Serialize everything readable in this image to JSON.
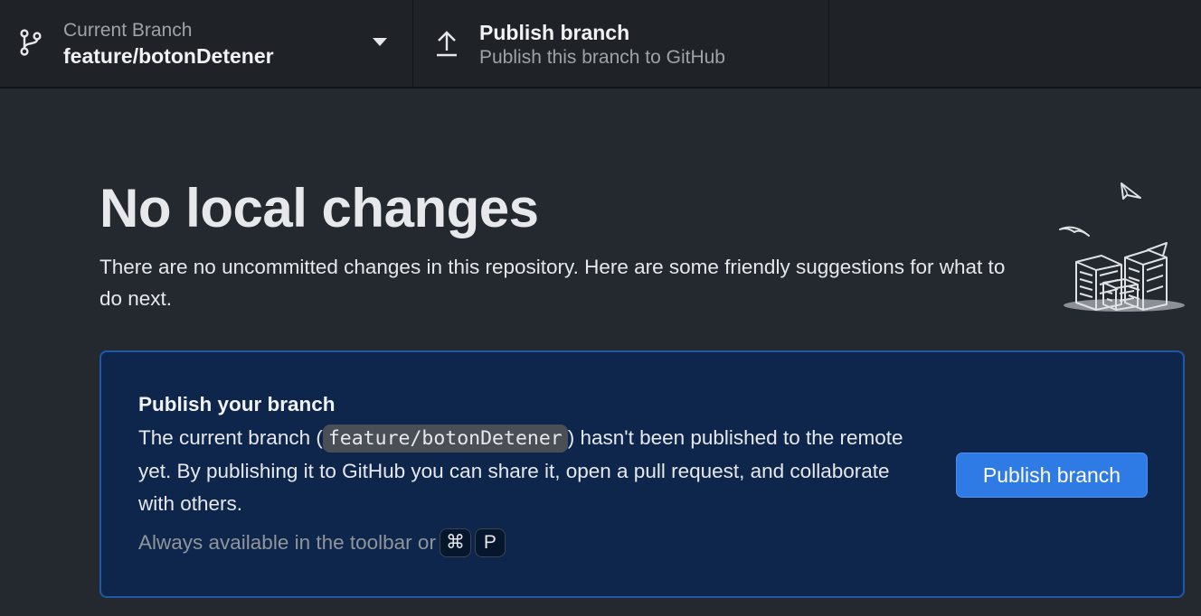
{
  "toolbar": {
    "branch": {
      "caption": "Current Branch",
      "name": "feature/botonDetener",
      "icon": "git-branch-icon"
    },
    "publish": {
      "title": "Publish branch",
      "description": "Publish this branch to GitHub",
      "icon": "upload-icon"
    }
  },
  "main": {
    "heading": "No local changes",
    "subtitle": "There are no uncommitted changes in this repository. Here are some friendly suggestions for what to do next.",
    "illustration": "paper-stacks-illustration"
  },
  "card": {
    "title": "Publish your branch",
    "desc_before": "The current branch (",
    "branch_code": "feature/botonDetener",
    "desc_after": ") hasn't been published to the remote yet. By publishing it to GitHub you can share it, open a pull request, and collaborate with others.",
    "hint": "Always available in the toolbar or",
    "key_modifier": "⌘",
    "key_letter": "P",
    "button_label": "Publish branch"
  },
  "colors": {
    "background": "#24292f",
    "toolbar": "#1f2328",
    "card_background": "#0e264b",
    "card_border": "#1f58a8",
    "button": "#2f7be6"
  }
}
